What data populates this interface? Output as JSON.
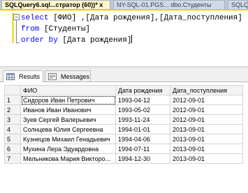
{
  "doc_tabs": [
    {
      "label": "SQLQuery6.sql...стратор (60))*",
      "active": true
    },
    {
      "label": "NY-SQL-01.PGS... dbo.Студенты",
      "active": false
    },
    {
      "label": "SQLQ",
      "active": false
    }
  ],
  "close_glyph": "x",
  "editor": {
    "line1": {
      "kw": "select",
      "rest": " [ФИО] ,[Дата рождения],[Дата_поступления]"
    },
    "line2": {
      "kw": "from",
      "rest": " [Студенты]"
    },
    "line3": {
      "kw": "order by",
      "rest": " [Дата рождения]"
    }
  },
  "results_tabs": [
    {
      "label": "Results",
      "icon": "grid-icon",
      "active": true
    },
    {
      "label": "Messages",
      "icon": "messages-icon",
      "active": false
    }
  ],
  "grid": {
    "columns": [
      "ФИО",
      "Дата рождения",
      "Дата_поступления"
    ],
    "rows": [
      {
        "n": "1",
        "fio": "Сидоров Иван Петрович",
        "dob": "1993-04-12",
        "adm": "2012-09-01"
      },
      {
        "n": "2",
        "fio": "Иванов Иван Иванович",
        "dob": "1993-05-02",
        "adm": "2012-09-01"
      },
      {
        "n": "3",
        "fio": "Зуев Сергей Валерьевич",
        "dob": "1993-11-24",
        "adm": "2012-09-01"
      },
      {
        "n": "4",
        "fio": "Солнцева Юлия Сергеевна",
        "dob": "1994-01-01",
        "adm": "2013-09-01"
      },
      {
        "n": "5",
        "fio": "Кузнецов Михаил Генадьевич",
        "dob": "1994-04-06",
        "adm": "2013-09-01"
      },
      {
        "n": "6",
        "fio": "Мухина Лера Эдуардовна",
        "dob": "1994-07-11",
        "adm": "2013-09-01"
      },
      {
        "n": "7",
        "fio": "Мельникова Мария Викторо...",
        "dob": "1994-12-30",
        "adm": "2013-09-01"
      }
    ]
  },
  "colors": {
    "accent_tab": "#fdf6c9",
    "keyword": "#0000ff",
    "change_bar": "#f6e04d"
  }
}
